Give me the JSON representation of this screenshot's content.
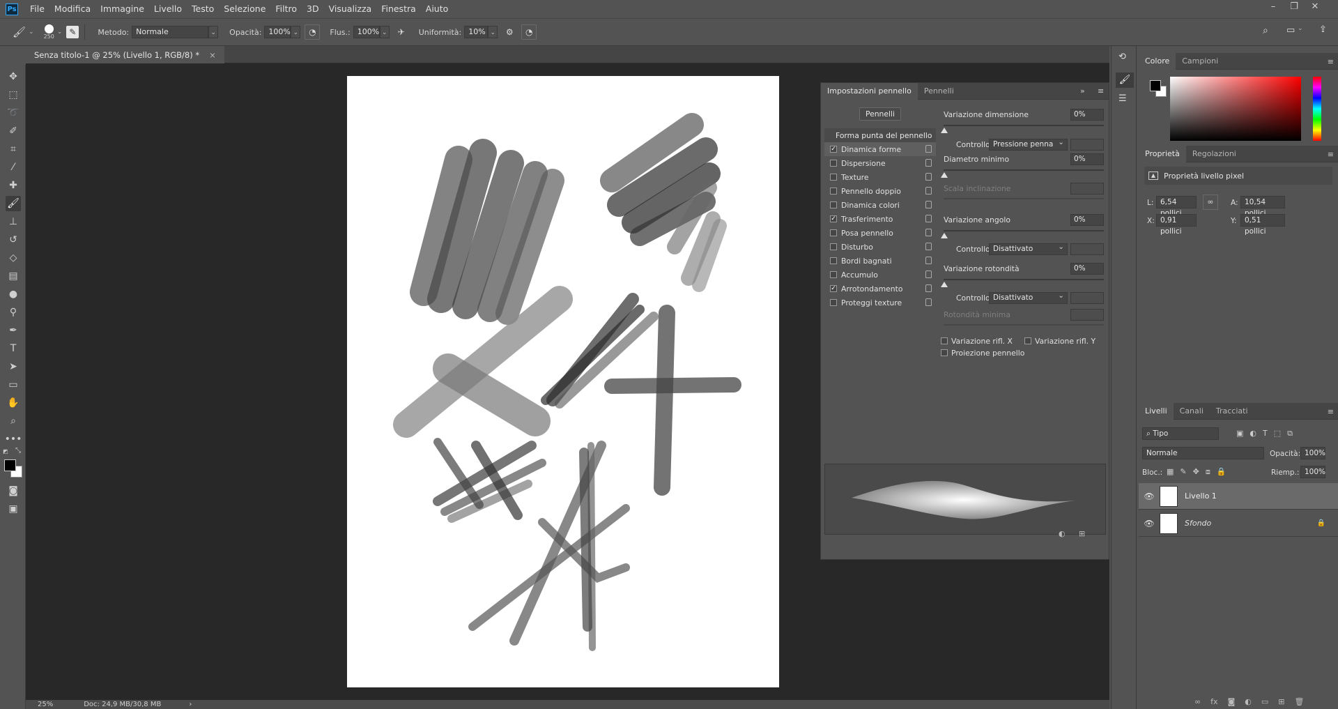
{
  "app": {
    "logo": "Ps"
  },
  "menu": [
    "File",
    "Modifica",
    "Immagine",
    "Livello",
    "Testo",
    "Selezione",
    "Filtro",
    "3D",
    "Visualizza",
    "Finestra",
    "Aiuto"
  ],
  "options": {
    "brush_size": "250",
    "metodo_label": "Metodo:",
    "metodo_value": "Normale",
    "opacita_label": "Opacità:",
    "opacita_value": "100%",
    "flusso_label": "Flus.:",
    "flusso_value": "100%",
    "uniformita_label": "Uniformità:",
    "uniformita_value": "10%"
  },
  "document": {
    "tab_title": "Senza titolo-1 @ 25% (Livello 1, RGB/8) *",
    "close": "×"
  },
  "status": {
    "zoom": "25%",
    "doc": "Doc: 24,9 MB/30,8 MB",
    "arrow": "›"
  },
  "brush_panel": {
    "tabs": [
      "Impostazioni pennello",
      "Pennelli"
    ],
    "pennelli_button": "Pennelli",
    "list": [
      {
        "label": "Forma punta del pennello",
        "header": true
      },
      {
        "label": "Dinamica forme",
        "checked": true,
        "active": true
      },
      {
        "label": "Dispersione",
        "checked": false
      },
      {
        "label": "Texture",
        "checked": false
      },
      {
        "label": "Pennello doppio",
        "checked": false
      },
      {
        "label": "Dinamica colori",
        "checked": false
      },
      {
        "label": "Trasferimento",
        "checked": true
      },
      {
        "label": "Posa pennello",
        "checked": false
      },
      {
        "label": "Disturbo",
        "checked": false
      },
      {
        "label": "Bordi bagnati",
        "checked": false
      },
      {
        "label": "Accumulo",
        "checked": false
      },
      {
        "label": "Arrotondamento",
        "checked": true
      },
      {
        "label": "Proteggi texture",
        "checked": false
      }
    ],
    "settings": {
      "var_dim": "Variazione dimensione",
      "var_dim_val": "0%",
      "controllo": "Controllo:",
      "ctrl1": "Pressione penna",
      "diam_min": "Diametro minimo",
      "diam_min_val": "0%",
      "scala_incl": "Scala inclinazione",
      "var_ang": "Variazione angolo",
      "var_ang_val": "0%",
      "ctrl2": "Disattivato",
      "var_rot": "Variazione rotondità",
      "var_rot_val": "0%",
      "ctrl3": "Disattivato",
      "rot_min": "Rotondità minima",
      "rifl_x": "Variazione rifl. X",
      "rifl_y": "Variazione rifl. Y",
      "proiezione": "Proiezione pennello"
    }
  },
  "color_panel": {
    "tabs": [
      "Colore",
      "Campioni"
    ]
  },
  "properties_panel": {
    "tabs": [
      "Proprietà",
      "Regolazioni"
    ],
    "title": "Proprietà livello pixel",
    "l_label": "L:",
    "l_value": "6,54 pollici",
    "a_label": "A:",
    "a_value": "10,54 pollici",
    "x_label": "X:",
    "x_value": "0,91 pollici",
    "y_label": "Y:",
    "y_value": "0,51 pollici"
  },
  "layers_panel": {
    "tabs": [
      "Livelli",
      "Canali",
      "Tracciati"
    ],
    "filter": "Tipo",
    "blend": "Normale",
    "opacity_label": "Opacità:",
    "opacity_value": "100%",
    "lock_label": "Bloc.:",
    "fill_label": "Riemp.:",
    "fill_value": "100%",
    "layers": [
      {
        "name": "Livello 1",
        "active": true
      },
      {
        "name": "Sfondo",
        "active": false
      }
    ]
  },
  "colors": {
    "accent": "#31a8ff",
    "bg": "#535353",
    "workspace": "#282828"
  }
}
